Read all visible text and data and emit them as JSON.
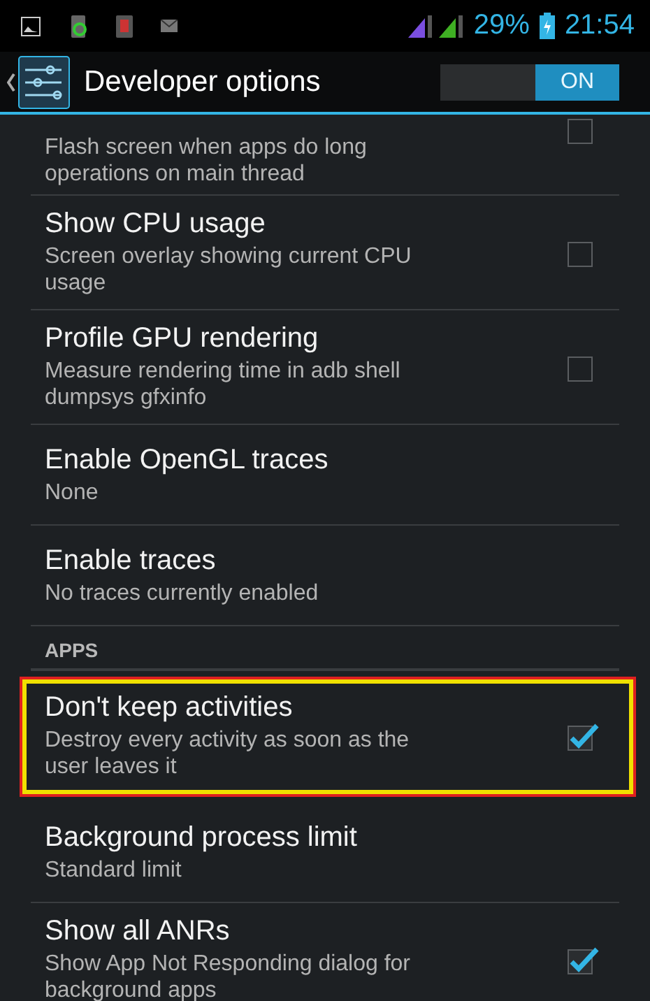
{
  "status_bar": {
    "battery": "29%",
    "time": "21:54"
  },
  "action_bar": {
    "title": "Developer options",
    "switch": {
      "label": "ON",
      "on": true
    }
  },
  "items": [
    {
      "kind": "checkbox",
      "summary": "Flash screen when apps do long operations on main thread",
      "checked": false,
      "highlighted": false
    },
    {
      "kind": "checkbox",
      "title": "Show CPU usage",
      "summary": "Screen overlay showing current CPU usage",
      "checked": false,
      "highlighted": false
    },
    {
      "kind": "checkbox",
      "title": "Profile GPU rendering",
      "summary": "Measure rendering time in adb shell dumpsys gfxinfo",
      "checked": false,
      "highlighted": false
    },
    {
      "kind": "list",
      "title": "Enable OpenGL traces",
      "summary": "None",
      "highlighted": false
    },
    {
      "kind": "list",
      "title": "Enable traces",
      "summary": "No traces currently enabled",
      "highlighted": false
    },
    {
      "kind": "header",
      "title": "APPS"
    },
    {
      "kind": "checkbox",
      "title": "Don't keep activities",
      "summary": "Destroy every activity as soon as the user leaves it",
      "checked": true,
      "highlighted": true
    },
    {
      "kind": "list",
      "title": "Background process limit",
      "summary": "Standard limit",
      "highlighted": false
    },
    {
      "kind": "checkbox",
      "title": "Show all ANRs",
      "summary": "Show App Not Responding dialog for background apps",
      "checked": true,
      "highlighted": false
    }
  ]
}
